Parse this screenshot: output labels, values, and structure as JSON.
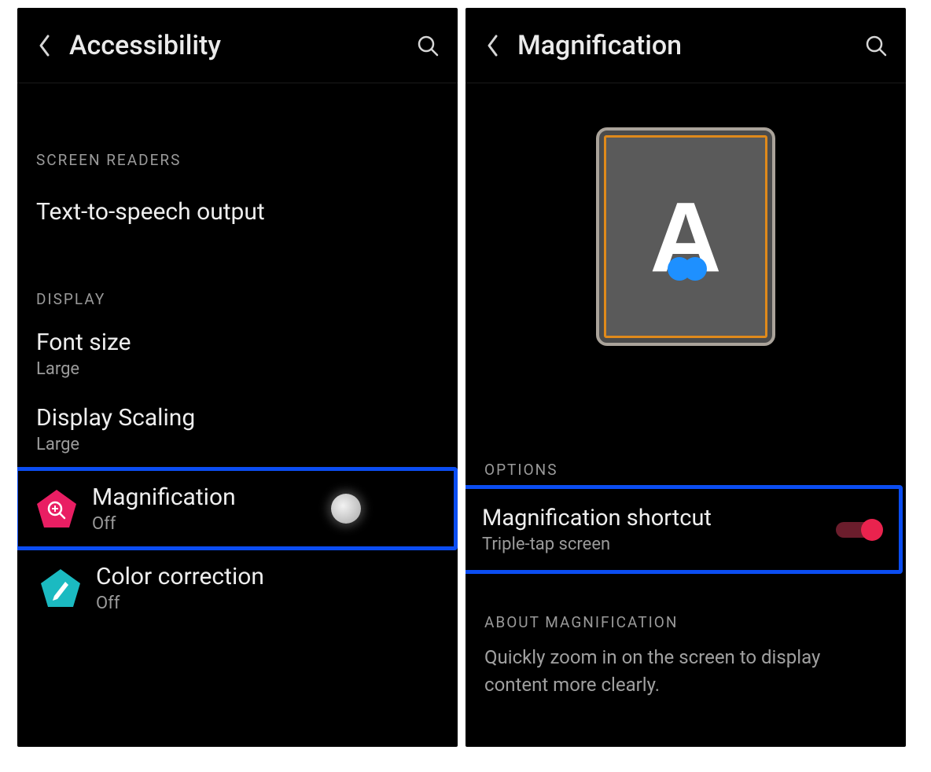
{
  "left": {
    "header_title": "Accessibility",
    "section_readers": "SCREEN READERS",
    "tts_label": "Text-to-speech output",
    "section_display": "DISPLAY",
    "font_size": {
      "label": "Font size",
      "value": "Large"
    },
    "display_scaling": {
      "label": "Display Scaling",
      "value": "Large"
    },
    "magnification": {
      "label": "Magnification",
      "value": "Off"
    },
    "color_correction": {
      "label": "Color correction",
      "value": "Off"
    }
  },
  "right": {
    "header_title": "Magnification",
    "section_options": "OPTIONS",
    "shortcut": {
      "label": "Magnification shortcut",
      "value": "Triple-tap screen",
      "enabled": true
    },
    "section_about": "ABOUT MAGNIFICATION",
    "about_text": "Quickly zoom in on the screen to display content more clearly."
  },
  "illustration": {
    "letter": "A"
  }
}
